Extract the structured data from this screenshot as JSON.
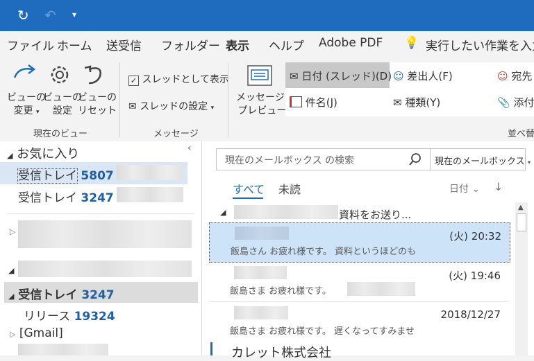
{
  "quick_access": {
    "sync_icon": "sync-icon",
    "undo_icon": "undo-icon",
    "more_icon": "customize-icon"
  },
  "tabs": [
    "ファイル",
    "ホーム",
    "送受信",
    "フォルダー",
    "表示",
    "ヘルプ",
    "Adobe PDF"
  ],
  "tell_me": "実行したい作業を入力",
  "ribbon": {
    "view_change": [
      "ビューの",
      "変更"
    ],
    "view_settings": [
      "ビューの",
      "設定"
    ],
    "view_reset": [
      "ビューの",
      "リセット"
    ],
    "current_view_group": "現在のビュー",
    "thread_show": "スレッドとして表示",
    "thread_settings": "スレッドの設定",
    "messages_group": "メッセージ",
    "message_preview": [
      "メッセージの",
      "プレビュー"
    ],
    "sort_date": "日付 (スレッド)(D)",
    "sort_from": "差出人(F)",
    "sort_to": "宛先",
    "sort_subject": "件名(J)",
    "sort_type": "種類(Y)",
    "sort_attach": "添付",
    "arrange_group": "並べ替"
  },
  "folders": {
    "favorites": "お気に入り",
    "fav_items": [
      {
        "label": "受信トレイ",
        "count": "5807",
        "suffix": "-"
      },
      {
        "label": "受信トレイ",
        "count": "3247",
        "suffix": "-"
      }
    ],
    "inbox": {
      "label": "受信トレイ",
      "count": "3247"
    },
    "release": {
      "label": "リリース",
      "count": "19324"
    },
    "gmail": "[Gmail]"
  },
  "mail": {
    "search_placeholder": "現在のメールボックス の検索",
    "scope": "現在のメールボックス",
    "filter_all": "すべて",
    "filter_unread": "未読",
    "sort_label": "日付",
    "group_subject": "資料をお送り...",
    "messages": [
      {
        "date": "(火) 20:32",
        "preview": "飯島さん お疲れ様です。 資料というほどのも"
      },
      {
        "date": "(火) 19:46",
        "preview": "飯島さま お疲れ様です。"
      },
      {
        "date": "2018/12/27",
        "preview": "飯島さま お疲れ様です。 遅くなってすみませ"
      }
    ],
    "next_sender": "カレット株式会社"
  }
}
